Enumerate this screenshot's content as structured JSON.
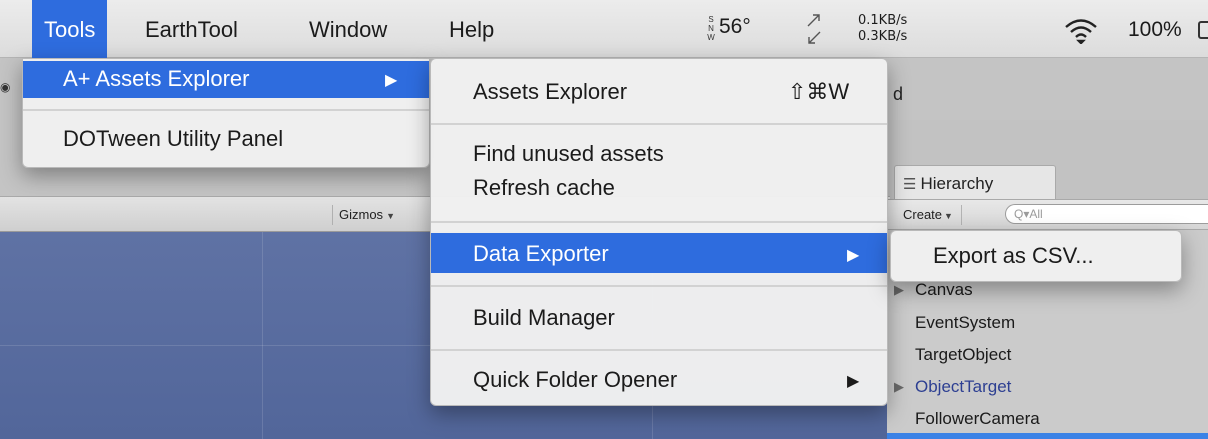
{
  "menubar": {
    "items": [
      {
        "label": "Tools",
        "active": true
      },
      {
        "label": "EarthTool",
        "active": false
      },
      {
        "label": "Window",
        "active": false
      },
      {
        "label": "Help",
        "active": false
      }
    ],
    "status": {
      "weather_glyph": "S\nN\nW",
      "temperature": "56°",
      "upload_rate": "0.1KB/s",
      "download_rate": "0.3KB/s",
      "battery": "100%"
    }
  },
  "tools_menu": {
    "items": [
      {
        "label": "A+ Assets Explorer",
        "has_submenu": true,
        "highlighted": true
      },
      {
        "label": "DOTween Utility Panel",
        "has_submenu": false,
        "highlighted": false
      }
    ]
  },
  "assets_submenu": {
    "items": [
      {
        "label": "Assets Explorer",
        "shortcut": "⇧⌘W"
      },
      {
        "label": "Find unused assets"
      },
      {
        "label": "Refresh cache"
      },
      {
        "label": "Data Exporter",
        "has_submenu": true,
        "highlighted": true
      },
      {
        "label": "Build Manager"
      },
      {
        "label": "Quick Folder Opener",
        "has_submenu": true
      }
    ]
  },
  "data_exporter_submenu": {
    "items": [
      {
        "label": "Export as CSV..."
      }
    ]
  },
  "scene": {
    "gizmos_label": "Gizmos",
    "partial_title": "d"
  },
  "hierarchy": {
    "tab_label": "Hierarchy",
    "create_label": "Create",
    "search_placeholder": "Q▾All",
    "items": [
      {
        "label": "Canvas",
        "expandable": true
      },
      {
        "label": "EventSystem"
      },
      {
        "label": "TargetObject"
      },
      {
        "label": "ObjectTarget",
        "expandable": true,
        "selected_style": true
      },
      {
        "label": "FollowerCamera"
      }
    ]
  },
  "colors": {
    "menu_highlight": "#2e6cde",
    "scene_blue": "#5a6da0",
    "hierarchy_link": "#2d3f92"
  }
}
